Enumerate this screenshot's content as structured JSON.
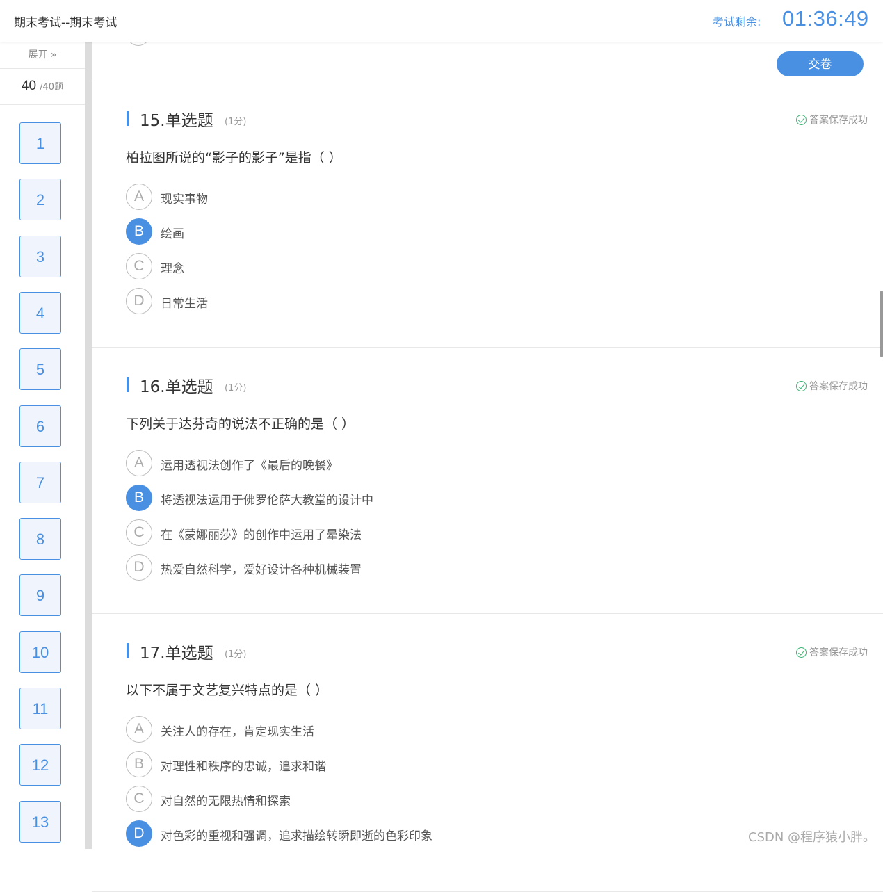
{
  "header": {
    "exam_title": "期末考试--期末考试",
    "timer_label": "考试剩余:",
    "timer_value": "01:36:49"
  },
  "sidebar": {
    "expand_label": "展开 »",
    "answered": "40",
    "total": "/40题",
    "question_numbers": [
      "1",
      "2",
      "3",
      "4",
      "5",
      "6",
      "7",
      "8",
      "9",
      "10",
      "11",
      "12",
      "13"
    ]
  },
  "toolbar": {
    "submit_label": "交卷"
  },
  "questions": [
    {
      "title": "15.单选题",
      "score": "(1分)",
      "saved_status": "答案保存成功",
      "stem": "柏拉图所说的“影子的影子”是指（  ）",
      "options": [
        {
          "letter": "A",
          "text": "现实事物",
          "selected": false
        },
        {
          "letter": "B",
          "text": "绘画",
          "selected": true
        },
        {
          "letter": "C",
          "text": "理念",
          "selected": false
        },
        {
          "letter": "D",
          "text": "日常生活",
          "selected": false
        }
      ]
    },
    {
      "title": "16.单选题",
      "score": "(1分)",
      "saved_status": "答案保存成功",
      "stem": "下列关于达芬奇的说法不正确的是（ ）",
      "options": [
        {
          "letter": "A",
          "text": "运用透视法创作了《最后的晚餐》",
          "selected": false
        },
        {
          "letter": "B",
          "text": "将透视法运用于佛罗伦萨大教堂的设计中",
          "selected": true
        },
        {
          "letter": "C",
          "text": "在《蒙娜丽莎》的创作中运用了晕染法",
          "selected": false
        },
        {
          "letter": "D",
          "text": "热爱自然科学，爱好设计各种机械装置",
          "selected": false
        }
      ]
    },
    {
      "title": "17.单选题",
      "score": "(1分)",
      "saved_status": "答案保存成功",
      "stem": "以下不属于文艺复兴特点的是（ ）",
      "options": [
        {
          "letter": "A",
          "text": "关注人的存在，肯定现实生活",
          "selected": false
        },
        {
          "letter": "B",
          "text": "对理性和秩序的忠诚，追求和谐",
          "selected": false
        },
        {
          "letter": "C",
          "text": "对自然的无限热情和探索",
          "selected": false
        },
        {
          "letter": "D",
          "text": "对色彩的重视和强调，追求描绘转瞬即逝的色彩印象",
          "selected": true
        }
      ]
    }
  ],
  "watermark": "CSDN @程序猿小胖。",
  "colors": {
    "accent": "#4a90e2",
    "success": "#3cb371"
  }
}
